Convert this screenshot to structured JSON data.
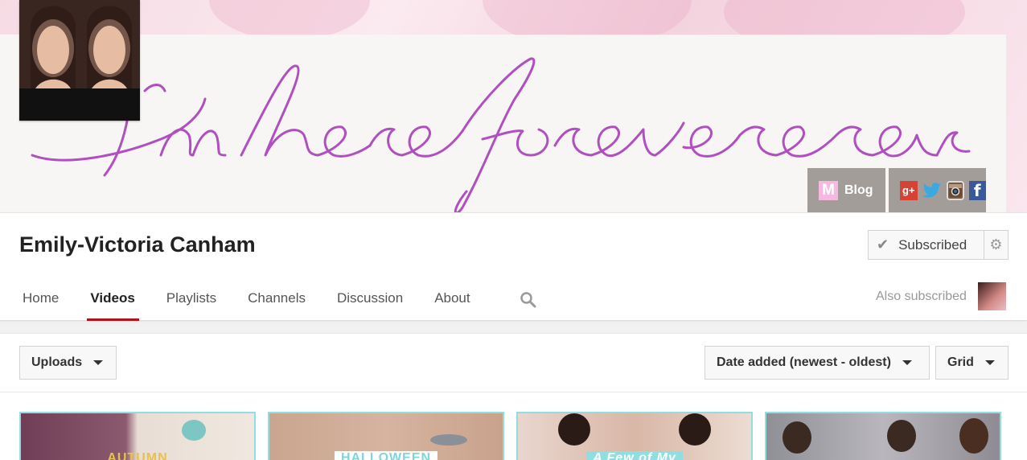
{
  "banner": {
    "script_text": "I'mhereforever",
    "blog_label": "Blog",
    "blog_icon": "M",
    "social_icons": [
      "gplus-icon",
      "twitter-icon",
      "instagram-icon",
      "facebook-icon"
    ],
    "gplus_glyph": "g+",
    "facebook_glyph": "f",
    "colors": {
      "script": "#b04fc0",
      "panel": "#827a76"
    }
  },
  "channel": {
    "title": "Emily-Victoria Canham",
    "subscribe_label": "Subscribed",
    "also_subscribed": "Also subscribed"
  },
  "tabs": [
    {
      "label": "Home",
      "active": false
    },
    {
      "label": "Videos",
      "active": true
    },
    {
      "label": "Playlists",
      "active": false
    },
    {
      "label": "Channels",
      "active": false
    },
    {
      "label": "Discussion",
      "active": false
    },
    {
      "label": "About",
      "active": false
    }
  ],
  "toolbar": {
    "uploads_label": "Uploads",
    "sort_label": "Date added (newest - oldest)",
    "view_label": "Grid"
  },
  "videos": [
    {
      "caption": "AUTUMN"
    },
    {
      "caption": "HALLOWEEN"
    },
    {
      "caption": "A Few of My"
    },
    {
      "caption": ""
    }
  ],
  "accent_color": "#b31217"
}
